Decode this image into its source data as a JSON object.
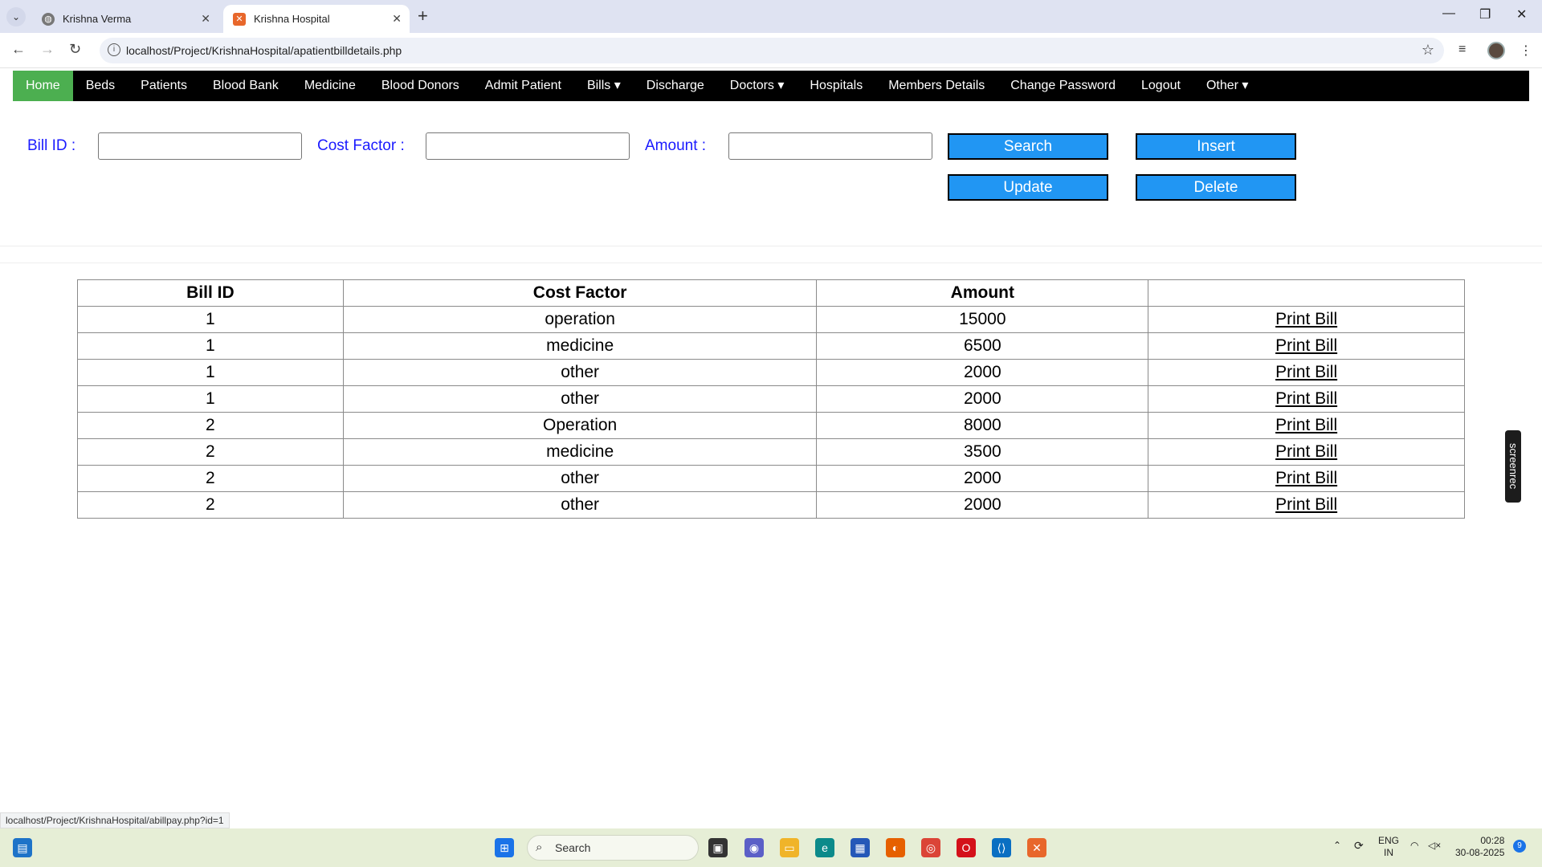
{
  "browser": {
    "tabs": [
      {
        "title": "Krishna Verma",
        "active": false
      },
      {
        "title": "Krishna Hospital",
        "active": true
      }
    ],
    "url": "localhost/Project/KrishnaHospital/apatientbilldetails.php",
    "status_url": "localhost/Project/KrishnaHospital/abillpay.php?id=1"
  },
  "nav": {
    "items": [
      "Home",
      "Beds",
      "Patients",
      "Blood Bank",
      "Medicine",
      "Blood Donors",
      "Admit Patient",
      "Bills ▾",
      "Discharge",
      "Doctors ▾",
      "Hospitals",
      "Members Details",
      "Change Password",
      "Logout",
      "Other ▾"
    ],
    "active_color": "#4caf50"
  },
  "form": {
    "bill_id_label": "Bill ID :",
    "cost_factor_label": "Cost Factor :",
    "amount_label": "Amount :",
    "bill_id_value": "",
    "cost_factor_value": "",
    "amount_value": "",
    "search_label": "Search",
    "insert_label": "Insert",
    "update_label": "Update",
    "delete_label": "Delete",
    "button_color": "#2196f3"
  },
  "table": {
    "headers": [
      "Bill ID",
      "Cost Factor",
      "Amount",
      ""
    ],
    "link_label": "Print Bill",
    "rows": [
      [
        "1",
        "operation",
        "15000"
      ],
      [
        "1",
        "medicine",
        "6500"
      ],
      [
        "1",
        "other",
        "2000"
      ],
      [
        "1",
        "other",
        "2000"
      ],
      [
        "2",
        "Operation",
        "8000"
      ],
      [
        "2",
        "medicine",
        "3500"
      ],
      [
        "2",
        "other",
        "2000"
      ],
      [
        "2",
        "other",
        "2000"
      ]
    ]
  },
  "overlay": {
    "screenrec": "screenrec"
  },
  "taskbar": {
    "search_placeholder": "Search",
    "lang": "ENG",
    "region": "IN",
    "time": "00:28",
    "date": "30-08-2025",
    "notification_count": "9"
  }
}
